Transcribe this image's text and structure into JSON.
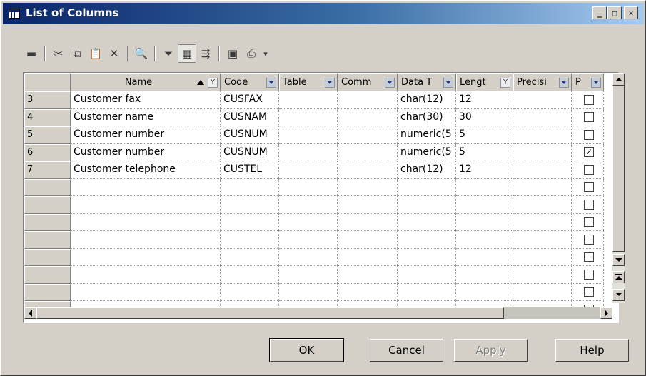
{
  "window": {
    "title": "List of Columns",
    "controls": {
      "minimize": "_",
      "maximize": "□",
      "close": "✕"
    }
  },
  "toolbar": {
    "items": [
      {
        "name": "properties-icon",
        "glyph": "▬"
      },
      {
        "name": "cut-icon",
        "glyph": "✂"
      },
      {
        "name": "copy-icon",
        "glyph": "⧉"
      },
      {
        "name": "paste-icon",
        "glyph": "📋"
      },
      {
        "name": "delete-icon",
        "glyph": "✕"
      },
      {
        "name": "find-icon",
        "glyph": "🔍"
      },
      {
        "name": "filter-icon",
        "glyph": "⏷"
      },
      {
        "name": "column-filter-icon",
        "glyph": "▦"
      },
      {
        "name": "customize-columns-icon",
        "glyph": "⇶"
      },
      {
        "name": "excel-export-icon",
        "glyph": "▣"
      },
      {
        "name": "print-icon",
        "glyph": "⎙"
      },
      {
        "name": "print-dropdown-icon",
        "glyph": "▾"
      }
    ]
  },
  "grid": {
    "columns": [
      {
        "label": "Name",
        "control": "filter",
        "sorted": true
      },
      {
        "label": "Code",
        "control": "dropdown"
      },
      {
        "label": "Table",
        "control": "dropdown"
      },
      {
        "label": "Comm",
        "control": "dropdown"
      },
      {
        "label": "Data T",
        "control": "dropdown"
      },
      {
        "label": "Lengt",
        "control": "filter"
      },
      {
        "label": "Precisi",
        "control": "dropdown"
      },
      {
        "label": "P",
        "control": "dropdown"
      }
    ],
    "rows": [
      {
        "num": "3",
        "name": "Customer fax",
        "code": "CUSFAX",
        "table": "",
        "comment": "",
        "datatype": "char(12)",
        "length": "12",
        "precision": "",
        "primary": false
      },
      {
        "num": "4",
        "name": "Customer name",
        "code": "CUSNAM",
        "table": "",
        "comment": "",
        "datatype": "char(30)",
        "length": "30",
        "precision": "",
        "primary": false
      },
      {
        "num": "5",
        "name": "Customer number",
        "code": "CUSNUM",
        "table": "",
        "comment": "",
        "datatype": "numeric(5",
        "length": "5",
        "precision": "",
        "primary": false
      },
      {
        "num": "6",
        "name": "Customer number",
        "code": "CUSNUM",
        "table": "",
        "comment": "",
        "datatype": "numeric(5",
        "length": "5",
        "precision": "",
        "primary": true
      },
      {
        "num": "7",
        "name": "Customer telephone",
        "code": "CUSTEL",
        "table": "",
        "comment": "",
        "datatype": "char(12)",
        "length": "12",
        "precision": "",
        "primary": false
      },
      {
        "num": "",
        "name": "",
        "code": "",
        "table": "",
        "comment": "",
        "datatype": "",
        "length": "",
        "precision": "",
        "primary": false
      },
      {
        "num": "",
        "name": "",
        "code": "",
        "table": "",
        "comment": "",
        "datatype": "",
        "length": "",
        "precision": "",
        "primary": false
      },
      {
        "num": "",
        "name": "",
        "code": "",
        "table": "",
        "comment": "",
        "datatype": "",
        "length": "",
        "precision": "",
        "primary": false
      },
      {
        "num": "",
        "name": "",
        "code": "",
        "table": "",
        "comment": "",
        "datatype": "",
        "length": "",
        "precision": "",
        "primary": false
      },
      {
        "num": "",
        "name": "",
        "code": "",
        "table": "",
        "comment": "",
        "datatype": "",
        "length": "",
        "precision": "",
        "primary": false
      },
      {
        "num": "",
        "name": "",
        "code": "",
        "table": "",
        "comment": "",
        "datatype": "",
        "length": "",
        "precision": "",
        "primary": false
      },
      {
        "num": "",
        "name": "",
        "code": "",
        "table": "",
        "comment": "",
        "datatype": "",
        "length": "",
        "precision": "",
        "primary": false
      },
      {
        "num": "",
        "name": "",
        "code": "",
        "table": "",
        "comment": "",
        "datatype": "",
        "length": "",
        "precision": "",
        "primary": false
      }
    ]
  },
  "buttons": {
    "ok": "OK",
    "cancel": "Cancel",
    "apply": "Apply",
    "help": "Help"
  },
  "colors": {
    "title_start": "#0a246a",
    "title_end": "#a6caf0",
    "face": "#d4d0c8"
  }
}
